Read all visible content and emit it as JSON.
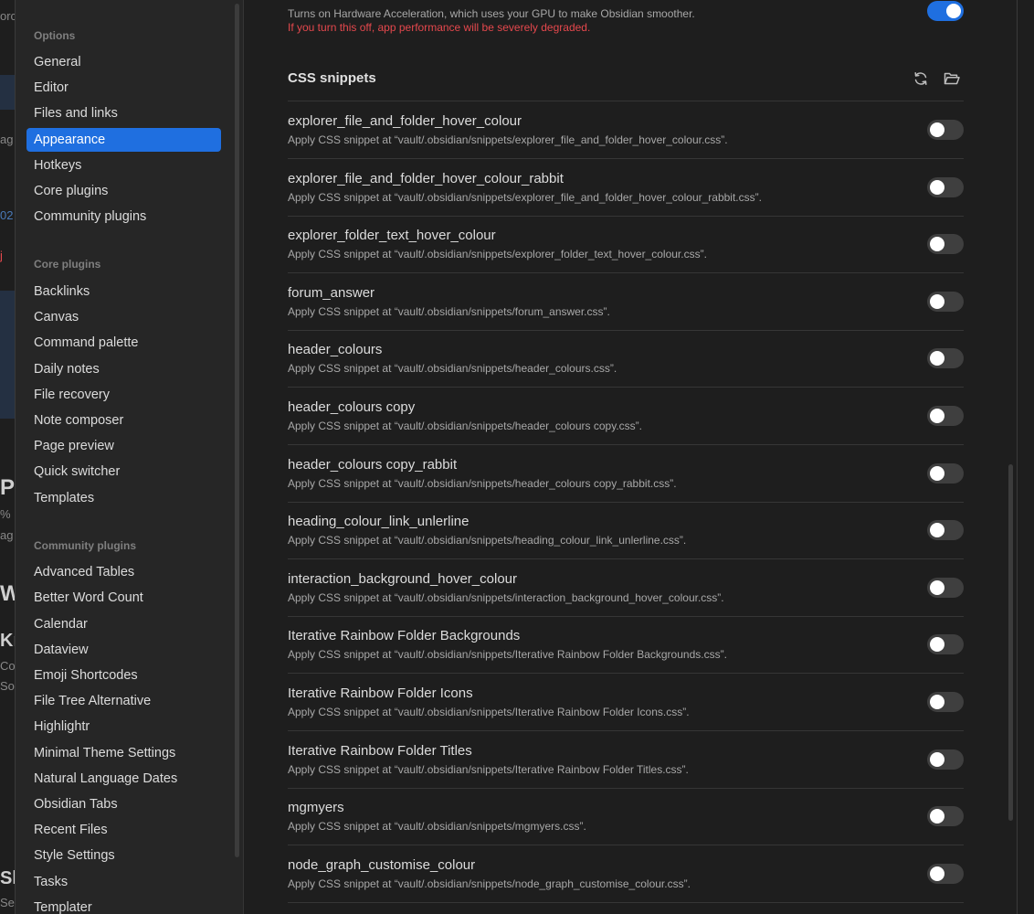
{
  "background_app": {
    "fragments": [
      "orc",
      "ag",
      "02",
      "j",
      "PI",
      "%",
      "ag",
      "W",
      "Kr",
      "Cor",
      "Sor",
      "Sk",
      "Set"
    ]
  },
  "close_label": "×",
  "sidebar": {
    "sections": [
      {
        "heading": "Options",
        "items": [
          "General",
          "Editor",
          "Files and links",
          "Appearance",
          "Hotkeys",
          "Core plugins",
          "Community plugins"
        ]
      },
      {
        "heading": "Core plugins",
        "items": [
          "Backlinks",
          "Canvas",
          "Command palette",
          "Daily notes",
          "File recovery",
          "Note composer",
          "Page preview",
          "Quick switcher",
          "Templates"
        ]
      },
      {
        "heading": "Community plugins",
        "items": [
          "Advanced Tables",
          "Better Word Count",
          "Calendar",
          "Dataview",
          "Emoji Shortcodes",
          "File Tree Alternative",
          "Highlightr",
          "Minimal Theme Settings",
          "Natural Language Dates",
          "Obsidian Tabs",
          "Recent Files",
          "Style Settings",
          "Tasks",
          "Templater"
        ]
      }
    ],
    "active_item": "Appearance"
  },
  "hardware_acceleration": {
    "description": "Turns on Hardware Acceleration, which uses your GPU to make Obsidian smoother.",
    "warning": "If you turn this off, app performance will be severely degraded.",
    "enabled": true
  },
  "css_snippets": {
    "title": "CSS snippets",
    "reload_icon": "reload-icon",
    "folder_icon": "open-folder-icon",
    "items": [
      {
        "name": "explorer_file_and_folder_hover_colour",
        "desc": "Apply CSS snippet at “vault/.obsidian/snippets/explorer_file_and_folder_hover_colour.css”.",
        "enabled": false
      },
      {
        "name": "explorer_file_and_folder_hover_colour_rabbit",
        "desc": "Apply CSS snippet at “vault/.obsidian/snippets/explorer_file_and_folder_hover_colour_rabbit.css”.",
        "enabled": false
      },
      {
        "name": "explorer_folder_text_hover_colour",
        "desc": "Apply CSS snippet at “vault/.obsidian/snippets/explorer_folder_text_hover_colour.css”.",
        "enabled": false
      },
      {
        "name": "forum_answer",
        "desc": "Apply CSS snippet at “vault/.obsidian/snippets/forum_answer.css”.",
        "enabled": false
      },
      {
        "name": "header_colours",
        "desc": "Apply CSS snippet at “vault/.obsidian/snippets/header_colours.css”.",
        "enabled": false
      },
      {
        "name": "header_colours copy",
        "desc": "Apply CSS snippet at “vault/.obsidian/snippets/header_colours copy.css”.",
        "enabled": false
      },
      {
        "name": "header_colours copy_rabbit",
        "desc": "Apply CSS snippet at “vault/.obsidian/snippets/header_colours copy_rabbit.css”.",
        "enabled": false
      },
      {
        "name": "heading_colour_link_unlerline",
        "desc": "Apply CSS snippet at “vault/.obsidian/snippets/heading_colour_link_unlerline.css”.",
        "enabled": false
      },
      {
        "name": "interaction_background_hover_colour",
        "desc": "Apply CSS snippet at “vault/.obsidian/snippets/interaction_background_hover_colour.css”.",
        "enabled": false
      },
      {
        "name": "Iterative Rainbow Folder Backgrounds",
        "desc": "Apply CSS snippet at “vault/.obsidian/snippets/Iterative Rainbow Folder Backgrounds.css”.",
        "enabled": false
      },
      {
        "name": "Iterative Rainbow Folder Icons",
        "desc": "Apply CSS snippet at “vault/.obsidian/snippets/Iterative Rainbow Folder Icons.css”.",
        "enabled": false
      },
      {
        "name": "Iterative Rainbow Folder Titles",
        "desc": "Apply CSS snippet at “vault/.obsidian/snippets/Iterative Rainbow Folder Titles.css”.",
        "enabled": false
      },
      {
        "name": "mgmyers",
        "desc": "Apply CSS snippet at “vault/.obsidian/snippets/mgmyers.css”.",
        "enabled": false
      },
      {
        "name": "node_graph_customise_colour",
        "desc": "Apply CSS snippet at “vault/.obsidian/snippets/node_graph_customise_colour.css”.",
        "enabled": false
      }
    ]
  },
  "colors": {
    "accent": "#1f6fe0",
    "warning": "#e5484d",
    "background": "#1e1e1e",
    "sidebar": "#262626"
  }
}
